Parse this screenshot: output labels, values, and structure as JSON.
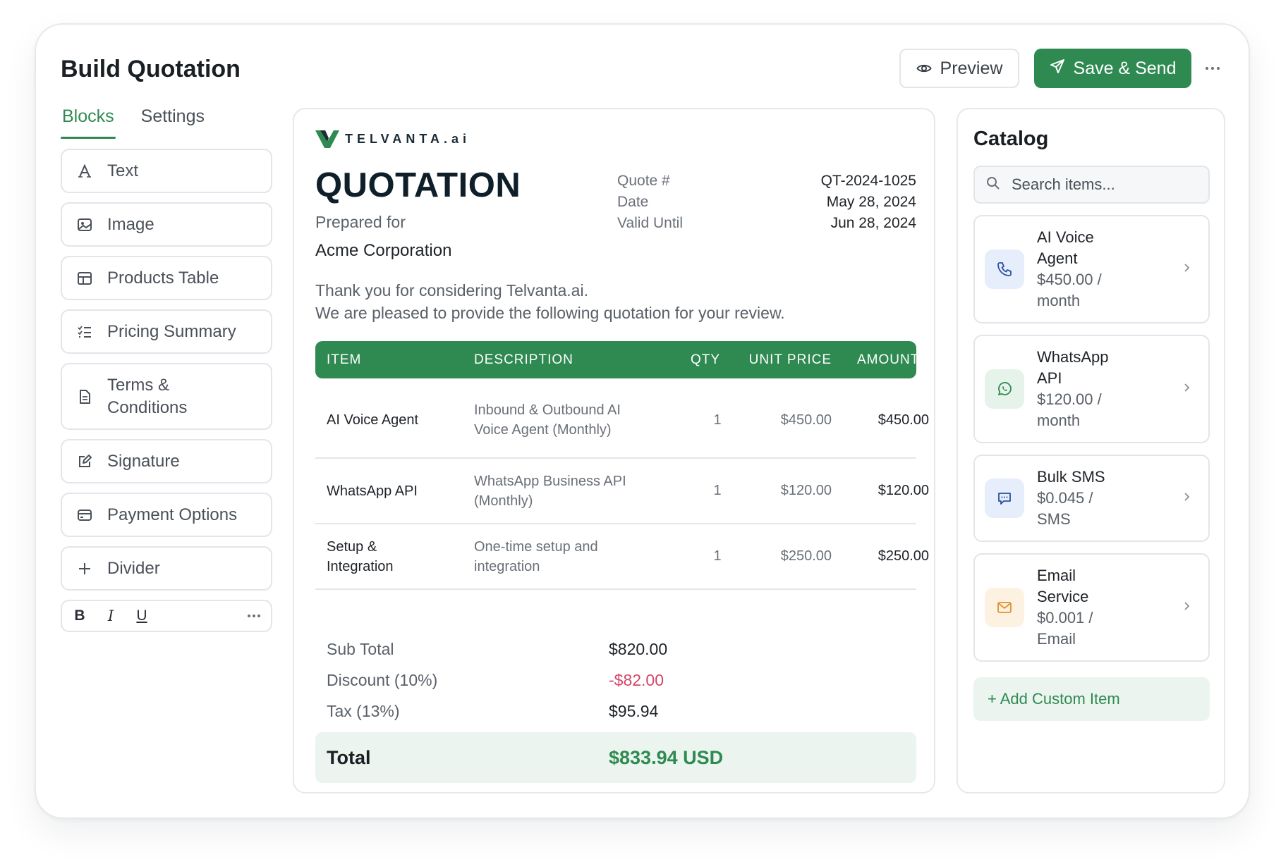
{
  "app": {
    "title": "Build Quotation"
  },
  "header": {
    "preview_label": "Preview",
    "save_send_label": "Save & Send"
  },
  "left_panel": {
    "tabs": [
      {
        "label": "Blocks",
        "active": true
      },
      {
        "label": "Settings",
        "active": false
      }
    ],
    "blocks": [
      {
        "label": "Text",
        "icon": "text-icon"
      },
      {
        "label": "Image",
        "icon": "image-icon"
      },
      {
        "label": "Products Table",
        "icon": "table-icon"
      },
      {
        "label": "Pricing Summary",
        "icon": "list-check-icon"
      },
      {
        "label": "Terms & Conditions",
        "icon": "document-icon"
      },
      {
        "label": "Signature",
        "icon": "pen-icon"
      },
      {
        "label": "Payment Options",
        "icon": "card-icon"
      },
      {
        "label": "Divider",
        "icon": "plus-icon"
      }
    ],
    "format_bar": {
      "bold": "B",
      "italic": "I",
      "underline": "U"
    }
  },
  "document": {
    "logo_text": "TELVANTA.ai",
    "heading": "QUOTATION",
    "prepared_for_label": "Prepared for",
    "client_name": "Acme Corporation",
    "meta": [
      {
        "label": "Quote #",
        "value": "QT-2024-1025"
      },
      {
        "label": "Date",
        "value": "May 28, 2024"
      },
      {
        "label": "Valid Until",
        "value": "Jun 28, 2024"
      }
    ],
    "intro_line1": "Thank you for considering Telvanta.ai.",
    "intro_line2": "We are pleased to provide the following quotation for your review.",
    "table": {
      "headers": {
        "item": "ITEM",
        "description": "DESCRIPTION",
        "qty": "QTY",
        "unit_price": "UNIT PRICE",
        "amount": "AMOUNT"
      },
      "rows": [
        {
          "item": "AI Voice Agent",
          "description": "Inbound & Outbound AI Voice Agent (Monthly)",
          "qty": "1",
          "unit_price": "$450.00",
          "amount": "$450.00"
        },
        {
          "item": "WhatsApp API",
          "description": "WhatsApp Business API (Monthly)",
          "qty": "1",
          "unit_price": "$120.00",
          "amount": "$120.00"
        },
        {
          "item": "Setup & Integration",
          "description": "One-time setup and integration",
          "qty": "1",
          "unit_price": "$250.00",
          "amount": "$250.00"
        }
      ]
    },
    "summary": {
      "subtotal_label": "Sub Total",
      "subtotal_value": "$820.00",
      "discount_label": "Discount (10%)",
      "discount_value": "-$82.00",
      "tax_label": "Tax (13%)",
      "tax_value": "$95.94",
      "total_label": "Total",
      "total_value": "$833.94 USD"
    }
  },
  "catalog": {
    "title": "Catalog",
    "search_placeholder": "Search items...",
    "items": [
      {
        "name": "AI Voice Agent",
        "price": "$450.00 / month",
        "icon": "phone-icon",
        "icon_color": "#2a4fa3",
        "icon_bg": "#e6eefb"
      },
      {
        "name": "WhatsApp API",
        "price": "$120.00 / month",
        "icon": "whatsapp-icon",
        "icon_color": "#2f8a52",
        "icon_bg": "#e5f3ea"
      },
      {
        "name": "Bulk SMS",
        "price": "$0.045 / SMS",
        "icon": "message-icon",
        "icon_color": "#2a4fa3",
        "icon_bg": "#e6eefb"
      },
      {
        "name": "Email Service",
        "price": "$0.001 / Email",
        "icon": "mail-icon",
        "icon_color": "#e0912b",
        "icon_bg": "#fdf1e2"
      }
    ],
    "add_custom_label": "+ Add Custom Item"
  },
  "colors": {
    "accent": "#2f8a52",
    "accent_soft": "#ebf4ee",
    "negative": "#d2476b"
  }
}
